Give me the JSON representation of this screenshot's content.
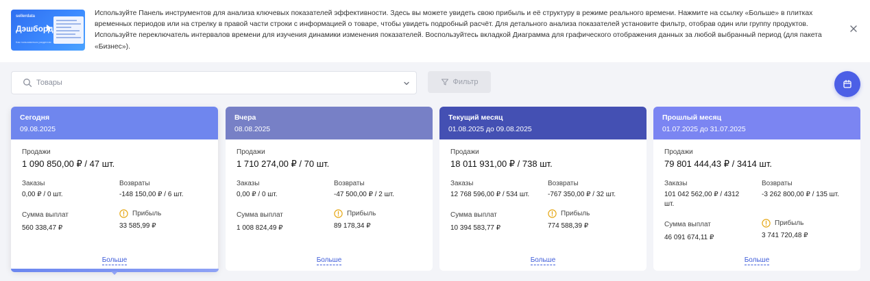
{
  "banner": {
    "thumb_brand": "sellerdata",
    "thumb_title": "Дэшборд",
    "thumb_sub": "Как пользоваться разделом",
    "text": "Используйте Панель инструментов для анализа ключевых показателей эффективности. Здесь вы можете увидеть свою прибыль и её структуру в режиме реального времени. Нажмите на ссылку «Больше» в плитках временных периодов или на стрелку в правой части строки с информацией о товаре, чтобы увидеть подробный расчёт. Для детального анализа показателей установите фильтр, отобрав один или группу продуктов. Используйте переключатель интервалов времени для изучения динамики изменения показателей. Воспользуйтесь вкладкой Диаграмма для графического отображения данных за любой выбранный период (для пакета «Бизнес»).",
    "close_icon": "close-icon"
  },
  "search": {
    "placeholder": "Товары",
    "value": ""
  },
  "filter": {
    "label": "Фильтр"
  },
  "colors": {
    "accent": "#4c5fe6",
    "today": "#6f86ee",
    "yesterday": "#7780c6",
    "month": "#4450b3",
    "last_month": "#7b85f2"
  },
  "labels": {
    "sales": "Продажи",
    "orders": "Заказы",
    "returns": "Возвраты",
    "payout": "Сумма выплат",
    "profit": "Прибыль",
    "more": "Больше"
  },
  "cards": [
    {
      "name": "Сегодня",
      "period": "09.08.2025",
      "sales": "1 090 850,00 ₽ / 47 шт.",
      "orders": "0,00 ₽ / 0 шт.",
      "returns": "-148 150,00 ₽ / 6 шт.",
      "payout": "560 338,47 ₽",
      "profit": "33 585,99 ₽"
    },
    {
      "name": "Вчера",
      "period": "08.08.2025",
      "sales": "1 710 274,00 ₽ / 70 шт.",
      "orders": "0,00 ₽ / 0 шт.",
      "returns": "-47 500,00 ₽ / 2 шт.",
      "payout": "1 008 824,49 ₽",
      "profit": "89 178,34 ₽"
    },
    {
      "name": "Текущий месяц",
      "period": "01.08.2025 до 09.08.2025",
      "sales": "18 011 931,00 ₽ / 738 шт.",
      "orders": "12 768 596,00 ₽ / 534 шт.",
      "returns": "-767 350,00 ₽ / 32 шт.",
      "payout": "10 394 583,77 ₽",
      "profit": "774 588,39 ₽"
    },
    {
      "name": "Прошлый месяц",
      "period": "01.07.2025 до 31.07.2025",
      "sales": "79 801 444,43 ₽ / 3414 шт.",
      "orders": "101 042 562,00 ₽ / 4312 шт.",
      "returns": "-3 262 800,00 ₽ / 135 шт.",
      "payout": "46 091 674,11 ₽",
      "profit": "3 741 720,48 ₽"
    }
  ]
}
